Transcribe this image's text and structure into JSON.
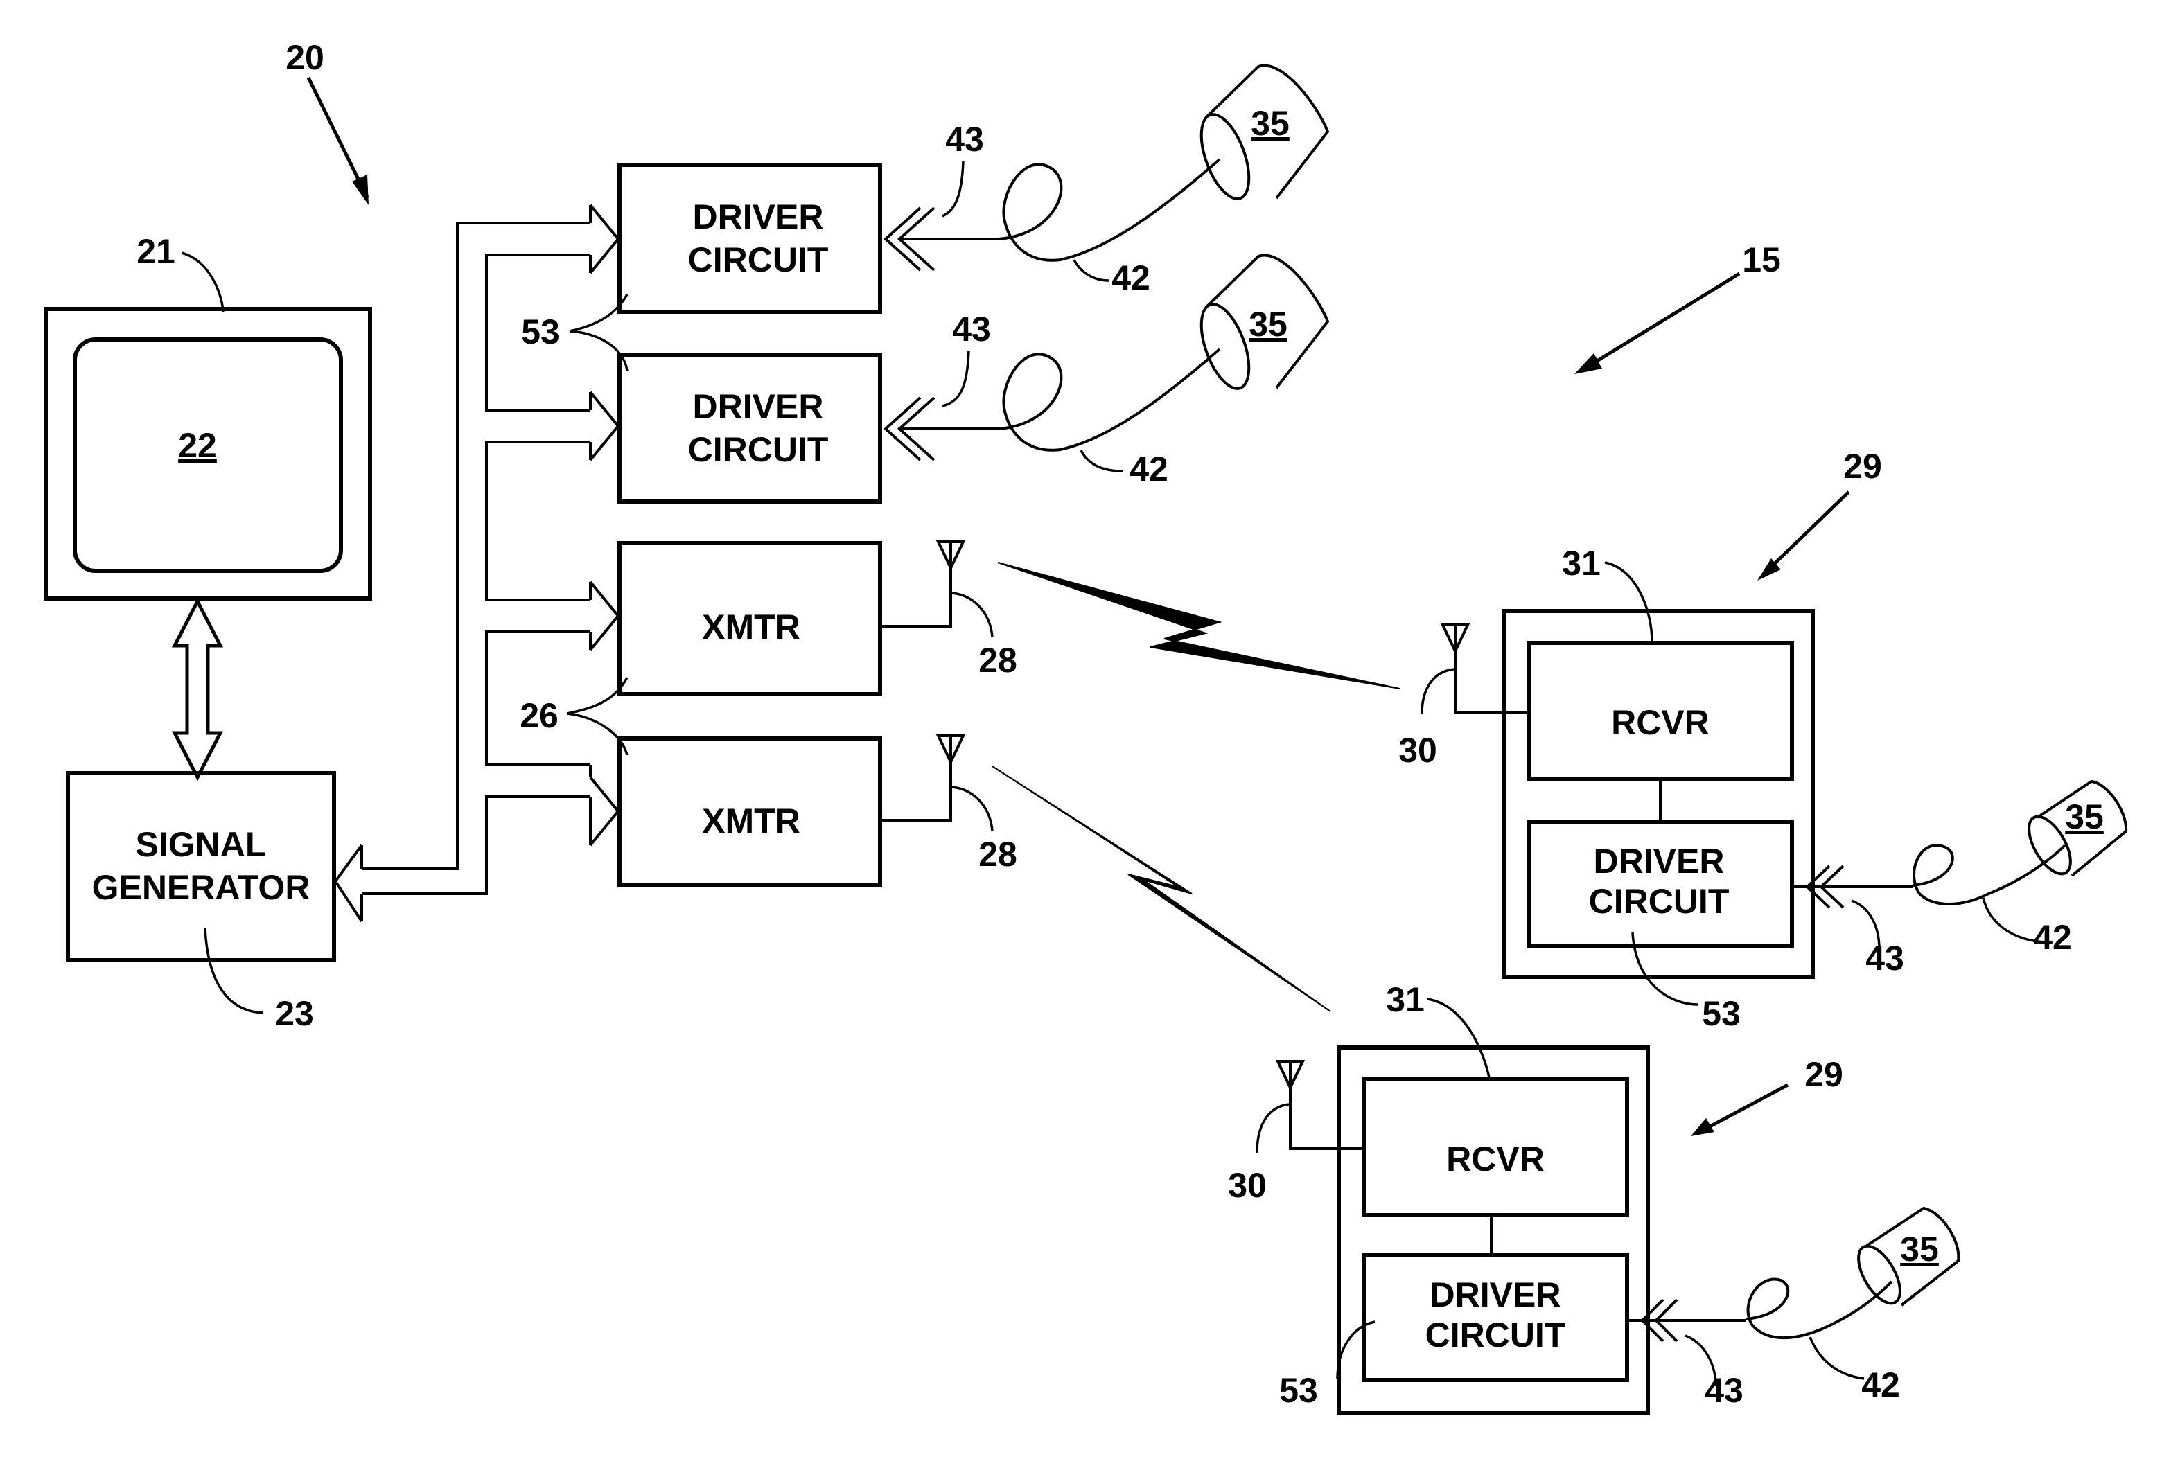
{
  "figure": {
    "system_ref": "20",
    "network_ref": "15"
  },
  "display": {
    "ref": "21",
    "screen_ref": "22"
  },
  "signal_generator": {
    "line1": "SIGNAL",
    "line2": "GENERATOR",
    "ref": "23"
  },
  "drivers": [
    {
      "line1": "DRIVER",
      "line2": "CIRCUIT",
      "connector_ref": "43",
      "cable_ref": "42",
      "electrode_ref": "35"
    },
    {
      "line1": "DRIVER",
      "line2": "CIRCUIT",
      "connector_ref": "43",
      "cable_ref": "42",
      "electrode_ref": "35"
    }
  ],
  "drivers_group_ref": "53",
  "transmitters": [
    {
      "label": "XMTR",
      "antenna_ref": "28"
    },
    {
      "label": "XMTR",
      "antenna_ref": "28"
    }
  ],
  "transmitters_group_ref": "26",
  "remote_units": [
    {
      "unit_ref": "29",
      "receiver": {
        "label": "RCVR",
        "ref": "31"
      },
      "antenna_ref": "30",
      "driver": {
        "line1": "DRIVER",
        "line2": "CIRCUIT",
        "ref": "53"
      },
      "connector_ref": "43",
      "cable_ref": "42",
      "electrode_ref": "35"
    },
    {
      "unit_ref": "29",
      "receiver": {
        "label": "RCVR",
        "ref": "31"
      },
      "antenna_ref": "30",
      "driver": {
        "line1": "DRIVER",
        "line2": "CIRCUIT",
        "ref": "53"
      },
      "connector_ref": "43",
      "cable_ref": "42",
      "electrode_ref": "35"
    }
  ]
}
